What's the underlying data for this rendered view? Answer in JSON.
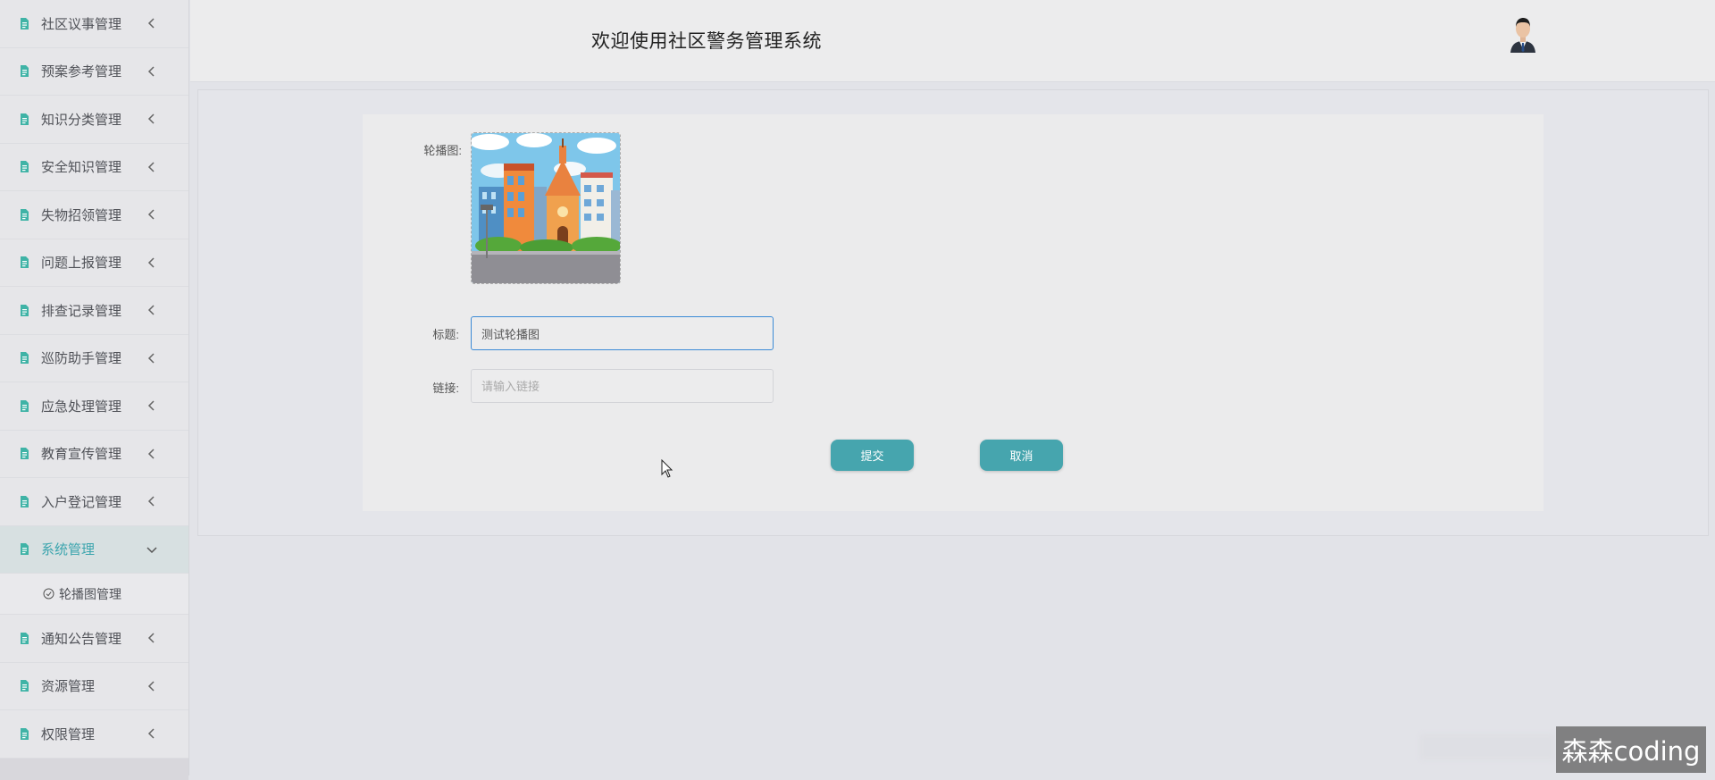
{
  "header": {
    "title": "欢迎使用社区警务管理系统"
  },
  "sidebar": {
    "items": [
      {
        "label": "社区议事管理"
      },
      {
        "label": "预案参考管理"
      },
      {
        "label": "知识分类管理"
      },
      {
        "label": "安全知识管理"
      },
      {
        "label": "失物招领管理"
      },
      {
        "label": "问题上报管理"
      },
      {
        "label": "排查记录管理"
      },
      {
        "label": "巡防助手管理"
      },
      {
        "label": "应急处理管理"
      },
      {
        "label": "教育宣传管理"
      },
      {
        "label": "入户登记管理"
      },
      {
        "label": "系统管理"
      },
      {
        "label": "通知公告管理"
      },
      {
        "label": "资源管理"
      },
      {
        "label": "权限管理"
      }
    ],
    "active_item": "系统管理",
    "submenu": {
      "label": "轮播图管理"
    }
  },
  "form": {
    "image_label": "轮播图:",
    "title_label": "标题:",
    "title_value": "测试轮播图",
    "link_label": "链接:",
    "link_placeholder": "请输入链接",
    "submit_label": "提交",
    "cancel_label": "取消"
  },
  "watermark": "森森coding",
  "colors": {
    "accent": "#46a5ae",
    "active_text": "#3ca5ae",
    "focus_border": "#3b8ad6"
  }
}
